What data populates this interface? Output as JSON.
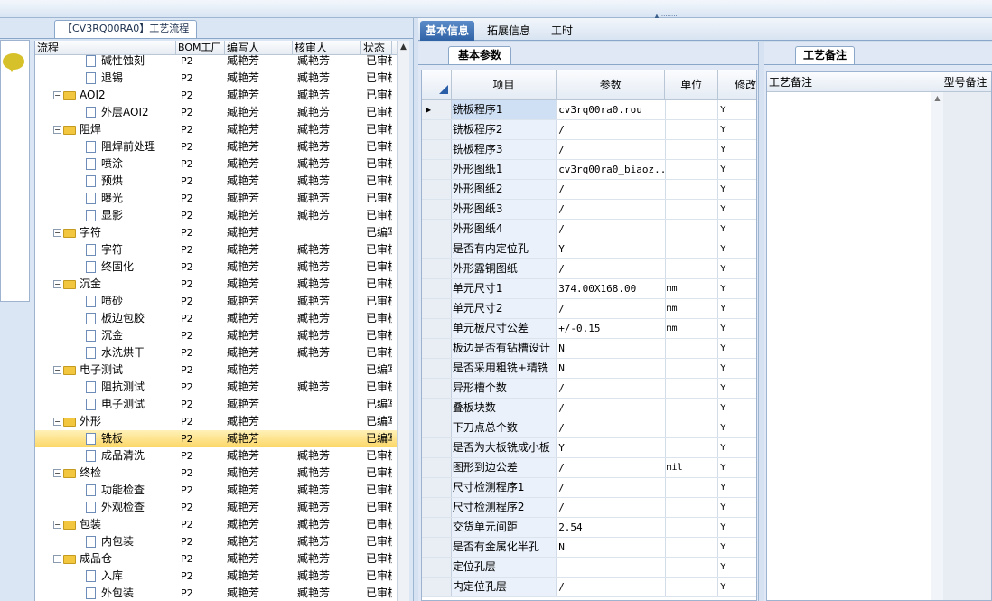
{
  "left_panel": {
    "tab_title": "【CV3RQ00RA0】工艺流程",
    "columns": [
      "流程",
      "BOM工厂",
      "编写人",
      "核审人",
      "状态"
    ],
    "rows": [
      {
        "name": "碱性蚀刻",
        "kind": "doc",
        "bom": "P2",
        "writer": "臧艳芳",
        "reviewer": "臧艳芳",
        "status": "已审核"
      },
      {
        "name": "退锡",
        "kind": "doc",
        "bom": "P2",
        "writer": "臧艳芳",
        "reviewer": "臧艳芳",
        "status": "已审核"
      },
      {
        "name": "AOI2",
        "kind": "folder",
        "bom": "P2",
        "writer": "臧艳芳",
        "reviewer": "臧艳芳",
        "status": "已审核"
      },
      {
        "name": "外层AOI2",
        "kind": "doc",
        "bom": "P2",
        "writer": "臧艳芳",
        "reviewer": "臧艳芳",
        "status": "已审核"
      },
      {
        "name": "阻焊",
        "kind": "folder",
        "bom": "P2",
        "writer": "臧艳芳",
        "reviewer": "臧艳芳",
        "status": "已审核"
      },
      {
        "name": "阻焊前处理",
        "kind": "doc",
        "bom": "P2",
        "writer": "臧艳芳",
        "reviewer": "臧艳芳",
        "status": "已审核"
      },
      {
        "name": "喷涂",
        "kind": "doc",
        "bom": "P2",
        "writer": "臧艳芳",
        "reviewer": "臧艳芳",
        "status": "已审核"
      },
      {
        "name": "预烘",
        "kind": "doc",
        "bom": "P2",
        "writer": "臧艳芳",
        "reviewer": "臧艳芳",
        "status": "已审核"
      },
      {
        "name": "曝光",
        "kind": "doc",
        "bom": "P2",
        "writer": "臧艳芳",
        "reviewer": "臧艳芳",
        "status": "已审核"
      },
      {
        "name": "显影",
        "kind": "doc",
        "bom": "P2",
        "writer": "臧艳芳",
        "reviewer": "臧艳芳",
        "status": "已审核"
      },
      {
        "name": "字符",
        "kind": "folder",
        "bom": "P2",
        "writer": "臧艳芳",
        "reviewer": "",
        "status": "已编写"
      },
      {
        "name": "字符",
        "kind": "doc",
        "bom": "P2",
        "writer": "臧艳芳",
        "reviewer": "臧艳芳",
        "status": "已审核"
      },
      {
        "name": "终固化",
        "kind": "doc",
        "bom": "P2",
        "writer": "臧艳芳",
        "reviewer": "臧艳芳",
        "status": "已审核"
      },
      {
        "name": "沉金",
        "kind": "folder",
        "bom": "P2",
        "writer": "臧艳芳",
        "reviewer": "臧艳芳",
        "status": "已审核"
      },
      {
        "name": "喷砂",
        "kind": "doc",
        "bom": "P2",
        "writer": "臧艳芳",
        "reviewer": "臧艳芳",
        "status": "已审核"
      },
      {
        "name": "板边包胶",
        "kind": "doc",
        "bom": "P2",
        "writer": "臧艳芳",
        "reviewer": "臧艳芳",
        "status": "已审核"
      },
      {
        "name": "沉金",
        "kind": "doc",
        "bom": "P2",
        "writer": "臧艳芳",
        "reviewer": "臧艳芳",
        "status": "已审核"
      },
      {
        "name": "水洗烘干",
        "kind": "doc",
        "bom": "P2",
        "writer": "臧艳芳",
        "reviewer": "臧艳芳",
        "status": "已审核"
      },
      {
        "name": "电子测试",
        "kind": "folder",
        "bom": "P2",
        "writer": "臧艳芳",
        "reviewer": "",
        "status": "已编写"
      },
      {
        "name": "阻抗测试",
        "kind": "doc",
        "bom": "P2",
        "writer": "臧艳芳",
        "reviewer": "臧艳芳",
        "status": "已审核"
      },
      {
        "name": "电子测试",
        "kind": "doc",
        "bom": "P2",
        "writer": "臧艳芳",
        "reviewer": "",
        "status": "已编写"
      },
      {
        "name": "外形",
        "kind": "folder",
        "bom": "P2",
        "writer": "臧艳芳",
        "reviewer": "",
        "status": "已编写"
      },
      {
        "name": "铣板",
        "kind": "doc",
        "bom": "P2",
        "writer": "臧艳芳",
        "reviewer": "",
        "status": "已编写",
        "selected": true
      },
      {
        "name": "成品清洗",
        "kind": "doc",
        "bom": "P2",
        "writer": "臧艳芳",
        "reviewer": "臧艳芳",
        "status": "已审核"
      },
      {
        "name": "终检",
        "kind": "folder",
        "bom": "P2",
        "writer": "臧艳芳",
        "reviewer": "臧艳芳",
        "status": "已审核"
      },
      {
        "name": "功能检查",
        "kind": "doc",
        "bom": "P2",
        "writer": "臧艳芳",
        "reviewer": "臧艳芳",
        "status": "已审核"
      },
      {
        "name": "外观检查",
        "kind": "doc",
        "bom": "P2",
        "writer": "臧艳芳",
        "reviewer": "臧艳芳",
        "status": "已审核"
      },
      {
        "name": "包装",
        "kind": "folder",
        "bom": "P2",
        "writer": "臧艳芳",
        "reviewer": "臧艳芳",
        "status": "已审核"
      },
      {
        "name": "内包装",
        "kind": "doc",
        "bom": "P2",
        "writer": "臧艳芳",
        "reviewer": "臧艳芳",
        "status": "已审核"
      },
      {
        "name": "成品仓",
        "kind": "folder",
        "bom": "P2",
        "writer": "臧艳芳",
        "reviewer": "臧艳芳",
        "status": "已审核"
      },
      {
        "name": "入库",
        "kind": "doc",
        "bom": "P2",
        "writer": "臧艳芳",
        "reviewer": "臧艳芳",
        "status": "已审核"
      },
      {
        "name": "外包装",
        "kind": "doc",
        "bom": "P2",
        "writer": "臧艳芳",
        "reviewer": "臧艳芳",
        "status": "已审核"
      }
    ]
  },
  "top_tabs": [
    "基本信息",
    "拓展信息",
    "工时"
  ],
  "params_panel": {
    "sub_tab": "基本参数",
    "columns": [
      "项目",
      "参数",
      "单位",
      "修改"
    ],
    "rows": [
      {
        "item": "铣板程序1",
        "value": "cv3rq00ra0.rou",
        "unit": "",
        "mod": "Y",
        "current": true
      },
      {
        "item": "铣板程序2",
        "value": "/",
        "unit": "",
        "mod": "Y"
      },
      {
        "item": "铣板程序3",
        "value": "/",
        "unit": "",
        "mod": "Y"
      },
      {
        "item": "外形图纸1",
        "value": "cv3rq00ra0_biaoz...",
        "unit": "",
        "mod": "Y"
      },
      {
        "item": "外形图纸2",
        "value": "/",
        "unit": "",
        "mod": "Y"
      },
      {
        "item": "外形图纸3",
        "value": "/",
        "unit": "",
        "mod": "Y"
      },
      {
        "item": "外形图纸4",
        "value": "/",
        "unit": "",
        "mod": "Y"
      },
      {
        "item": "是否有内定位孔",
        "value": "Y",
        "unit": "",
        "mod": "Y"
      },
      {
        "item": "外形露铜图纸",
        "value": "/",
        "unit": "",
        "mod": "Y"
      },
      {
        "item": "单元尺寸1",
        "value": "374.00X168.00",
        "unit": "mm",
        "mod": "Y"
      },
      {
        "item": "单元尺寸2",
        "value": "/",
        "unit": "mm",
        "mod": "Y"
      },
      {
        "item": "单元板尺寸公差",
        "value": "+/-0.15",
        "unit": "mm",
        "mod": "Y"
      },
      {
        "item": "板边是否有钻槽设计",
        "value": "N",
        "unit": "",
        "mod": "Y"
      },
      {
        "item": "是否采用粗铣+精铣",
        "value": "N",
        "unit": "",
        "mod": "Y"
      },
      {
        "item": "异形槽个数",
        "value": "/",
        "unit": "",
        "mod": "Y"
      },
      {
        "item": "叠板块数",
        "value": "/",
        "unit": "",
        "mod": "Y"
      },
      {
        "item": "下刀点总个数",
        "value": "/",
        "unit": "",
        "mod": "Y"
      },
      {
        "item": "是否为大板铣成小板",
        "value": "Y",
        "unit": "",
        "mod": "Y"
      },
      {
        "item": "图形到边公差",
        "value": "/",
        "unit": "mil",
        "mod": "Y"
      },
      {
        "item": "尺寸检测程序1",
        "value": "/",
        "unit": "",
        "mod": "Y"
      },
      {
        "item": "尺寸检测程序2",
        "value": "/",
        "unit": "",
        "mod": "Y"
      },
      {
        "item": "交货单元间距",
        "value": "2.54",
        "unit": "",
        "mod": "Y"
      },
      {
        "item": "是否有金属化半孔",
        "value": "N",
        "unit": "",
        "mod": "Y"
      },
      {
        "item": "定位孔层",
        "value": "",
        "unit": "",
        "mod": "Y"
      },
      {
        "item": "内定位孔层",
        "value": "/",
        "unit": "",
        "mod": "Y"
      }
    ]
  },
  "remarks_panel": {
    "tab": "工艺备注",
    "columns": [
      "工艺备注",
      "型号备注"
    ]
  },
  "colors": {
    "accent": "#2f62a6",
    "selection": "#fcd767",
    "panel_bg": "#dfe8f4"
  }
}
